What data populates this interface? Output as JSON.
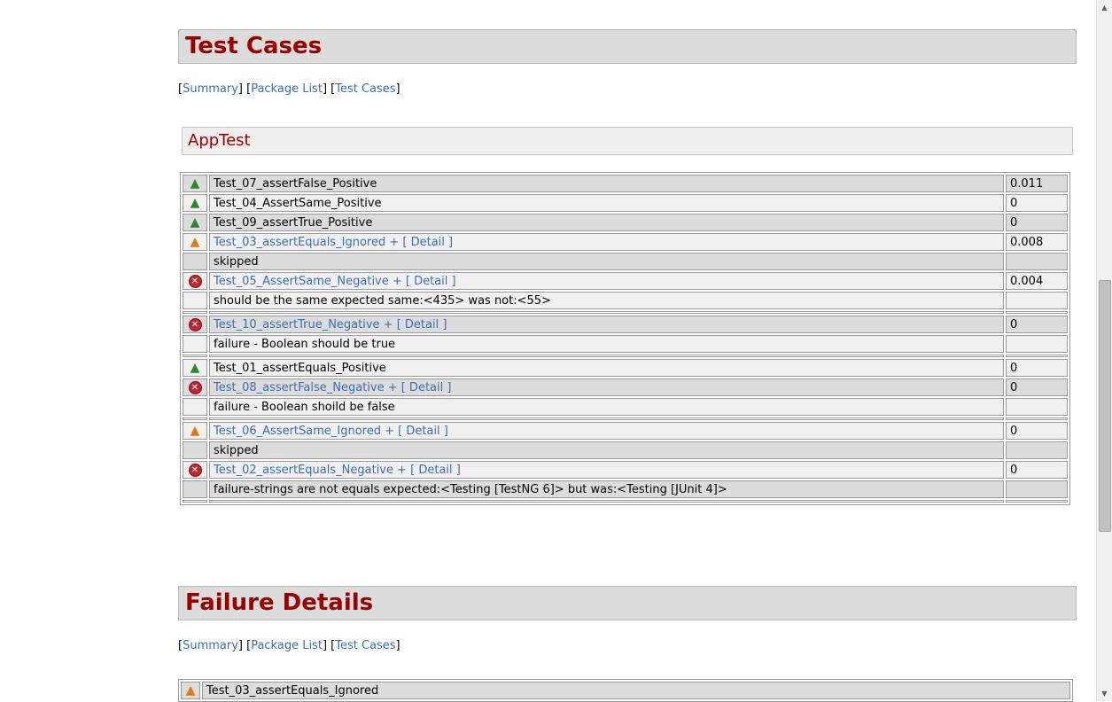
{
  "test_cases_section": {
    "title": "Test Cases",
    "nav": {
      "summary": "Summary",
      "package_list": "Package List",
      "test_cases": "Test Cases"
    }
  },
  "class_name": "AppTest",
  "rows": [
    {
      "kind": "result",
      "status": "pass",
      "name": "Test_07_assertFalse_Positive",
      "time": "0.011",
      "link": false,
      "shade": "g"
    },
    {
      "kind": "result",
      "status": "pass",
      "name": "Test_04_AssertSame_Positive",
      "time": "0",
      "link": false,
      "shade": "l"
    },
    {
      "kind": "result",
      "status": "pass",
      "name": "Test_09_assertTrue_Positive",
      "time": "0",
      "link": false,
      "shade": "g"
    },
    {
      "kind": "result",
      "status": "skip",
      "name": "Test_03_assertEquals_Ignored + [ Detail ]",
      "time": "0.008",
      "link": true,
      "shade": "l"
    },
    {
      "kind": "message",
      "text": "skipped",
      "shade": "g"
    },
    {
      "kind": "result",
      "status": "fail",
      "name": "Test_05_AssertSame_Negative + [ Detail ]",
      "time": "0.004",
      "link": true,
      "shade": "l"
    },
    {
      "kind": "message",
      "text": "should be the same expected same:<435> was not:<55>",
      "shade": "l"
    },
    {
      "kind": "sep"
    },
    {
      "kind": "result",
      "status": "fail",
      "name": "Test_10_assertTrue_Negative + [ Detail ]",
      "time": "0",
      "link": true,
      "shade": "g"
    },
    {
      "kind": "message",
      "text": "failure - Boolean should be true",
      "shade": "l"
    },
    {
      "kind": "sep"
    },
    {
      "kind": "result",
      "status": "pass",
      "name": "Test_01_assertEquals_Positive",
      "time": "0",
      "link": false,
      "shade": "l"
    },
    {
      "kind": "result",
      "status": "fail",
      "name": "Test_08_assertFalse_Negative + [ Detail ]",
      "time": "0",
      "link": true,
      "shade": "g"
    },
    {
      "kind": "message",
      "text": "failure - Boolean shoild be false",
      "shade": "l"
    },
    {
      "kind": "sep"
    },
    {
      "kind": "result",
      "status": "skip",
      "name": "Test_06_AssertSame_Ignored + [ Detail ]",
      "time": "0",
      "link": true,
      "shade": "l"
    },
    {
      "kind": "message",
      "text": "skipped",
      "shade": "g"
    },
    {
      "kind": "result",
      "status": "fail",
      "name": "Test_02_assertEquals_Negative + [ Detail ]",
      "time": "0",
      "link": true,
      "shade": "l"
    },
    {
      "kind": "message",
      "text": "failure-strings are not equals expected:<Testing [TestNG 6]> but was:<Testing [JUnit 4]>",
      "shade": "g"
    },
    {
      "kind": "sep"
    }
  ],
  "failure_details_section": {
    "title": "Failure Details",
    "nav": {
      "summary": "Summary",
      "package_list": "Package List",
      "test_cases": "Test Cases"
    }
  },
  "failure_first": {
    "status": "skip",
    "name": "Test_03_assertEquals_Ignored"
  },
  "icons": {
    "pass": "pass-check-icon",
    "skip": "warning-triangle-icon",
    "fail": "fail-x-icon"
  }
}
